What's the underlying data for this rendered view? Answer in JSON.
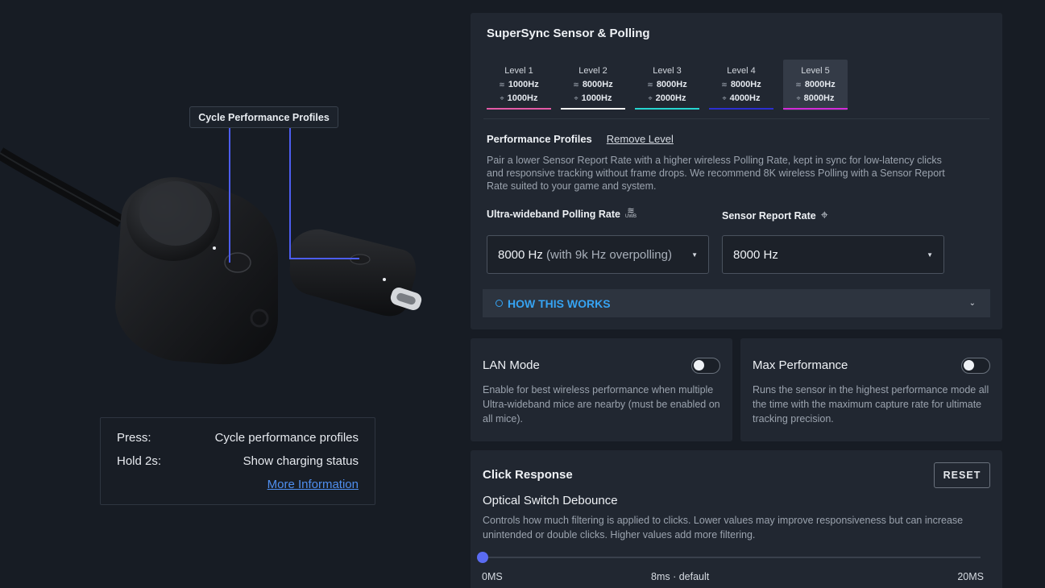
{
  "device": {
    "callout": "Cycle Performance Profiles",
    "info": {
      "rows": [
        {
          "key": "Press:",
          "value": "Cycle performance profiles"
        },
        {
          "key": "Hold 2s:",
          "value": "Show charging status"
        }
      ],
      "link": "More Information"
    }
  },
  "sensor": {
    "title": "SuperSync Sensor & Polling",
    "levels": [
      {
        "name": "Level 1",
        "polling": "1000Hz",
        "sensor": "1000Hz",
        "color": "#e35aa6",
        "selected": false
      },
      {
        "name": "Level 2",
        "polling": "8000Hz",
        "sensor": "1000Hz",
        "color": "#f2f2f2",
        "selected": false
      },
      {
        "name": "Level 3",
        "polling": "8000Hz",
        "sensor": "2000Hz",
        "color": "#27d5d0",
        "selected": false
      },
      {
        "name": "Level 4",
        "polling": "8000Hz",
        "sensor": "4000Hz",
        "color": "#2c2fd0",
        "selected": false
      },
      {
        "name": "Level 5",
        "polling": "8000Hz",
        "sensor": "8000Hz",
        "color": "#d32ad9",
        "selected": true
      }
    ],
    "profiles_label": "Performance Profiles",
    "remove_label": "Remove Level",
    "description": "Pair a lower Sensor Report Rate with a higher wireless Polling Rate, kept in sync for low-latency clicks and responsive tracking without frame drops. We recommend 8K wireless Polling with a Sensor Report Rate suited to your game and system.",
    "polling_label": "Ultra-wideband Polling Rate",
    "polling_icon_text": "UWB",
    "sensor_label": "Sensor Report Rate",
    "polling_value": "8000 Hz",
    "polling_value_suffix": "(with 9k Hz overpolling)",
    "sensor_value": "8000 Hz",
    "how_label": "HOW THIS WORKS"
  },
  "lan": {
    "title": "LAN Mode",
    "description": "Enable for best wireless performance when multiple Ultra-wideband mice are nearby (must be enabled on all mice).",
    "enabled": false
  },
  "max": {
    "title": "Max Performance",
    "description": "Runs the sensor in the highest performance mode all the time with the maximum capture rate for ultimate tracking precision.",
    "enabled": false
  },
  "click": {
    "title": "Click Response",
    "reset_label": "RESET",
    "subtitle": "Optical Switch Debounce",
    "description": "Controls how much filtering is applied to clicks. Lower values may improve responsiveness but can increase unintended or double clicks. Higher values add more filtering.",
    "slider": {
      "min_label": "0MS",
      "default_label": "8ms · default",
      "max_label": "20MS",
      "value": 0,
      "min": 0,
      "max": 20
    }
  },
  "colors": {
    "accent": "#5a6bf2",
    "link": "#4f8ff0",
    "how": "#36a3f2"
  }
}
